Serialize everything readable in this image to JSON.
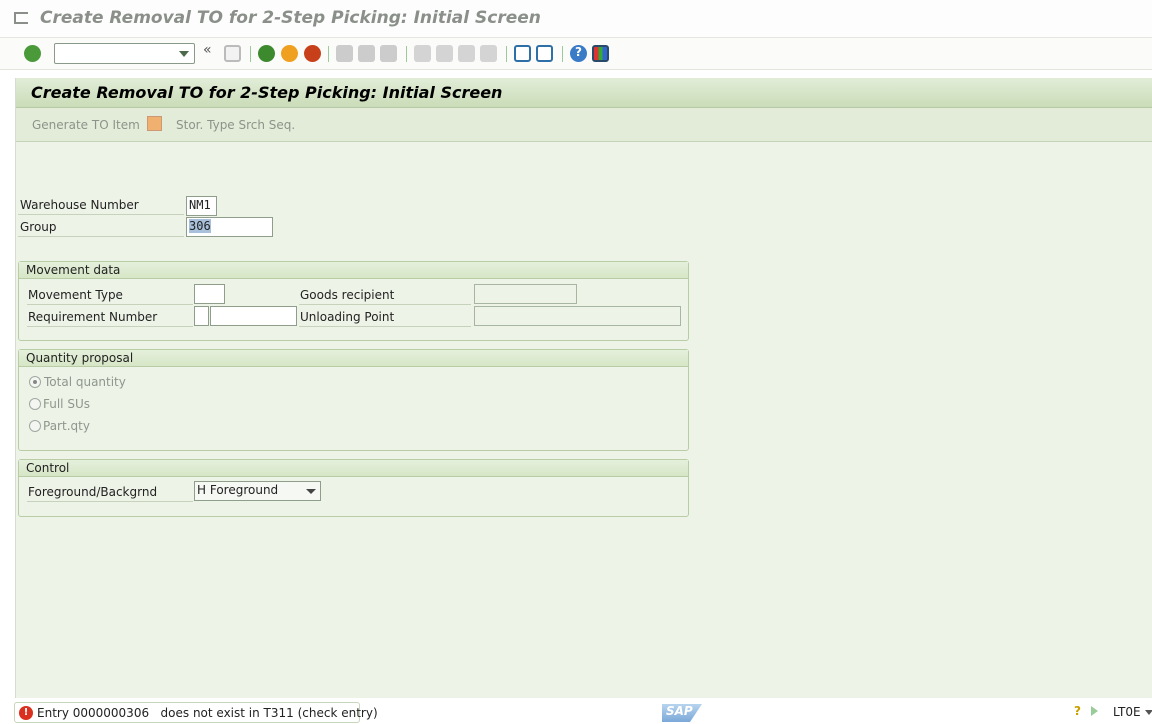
{
  "window": {
    "title": "Create Removal TO for 2-Step Picking: Initial Screen"
  },
  "toolbar": {
    "command_field": "",
    "icons": [
      "enter-icon",
      "back-icon",
      "exit-icon",
      "cancel-icon",
      "save-icon",
      "print-icon",
      "find-icon",
      "find-next-icon",
      "first-page-icon",
      "previous-page-icon",
      "next-page-icon",
      "last-page-icon",
      "new-session-icon",
      "shortcut-icon",
      "help-icon",
      "customize-layout-icon"
    ]
  },
  "header": {
    "title": "Create Removal TO for 2-Step Picking: Initial Screen"
  },
  "app_toolbar": {
    "generate": "Generate TO Item",
    "search_seq": "Stor. Type Srch Seq."
  },
  "fields": {
    "warehouse": {
      "label": "Warehouse Number",
      "value": "NM1"
    },
    "group": {
      "label": "Group",
      "value": "306"
    }
  },
  "movement": {
    "title": "Movement data",
    "movement_type": {
      "label": "Movement Type",
      "value": ""
    },
    "requirement": {
      "label": "Requirement Number",
      "value1": "",
      "value2": ""
    },
    "goods_recipient": {
      "label": "Goods recipient",
      "value": ""
    },
    "unloading_point": {
      "label": "Unloading Point",
      "value": ""
    }
  },
  "quantity": {
    "title": "Quantity proposal",
    "options": [
      "Total quantity",
      "Full SUs",
      "Part.qty"
    ],
    "selected": "Total quantity"
  },
  "control": {
    "title": "Control",
    "fg_label": "Foreground/Backgrnd",
    "fg_value": "H Foreground"
  },
  "status": {
    "message": "Entry 0000000306   does not exist in T311 (check entry)",
    "type": "error",
    "transaction": "LT0E",
    "logo": "SAP"
  },
  "colors": {
    "background": "#eef3e8",
    "header": "#cadcb8",
    "error": "#d9301f"
  }
}
